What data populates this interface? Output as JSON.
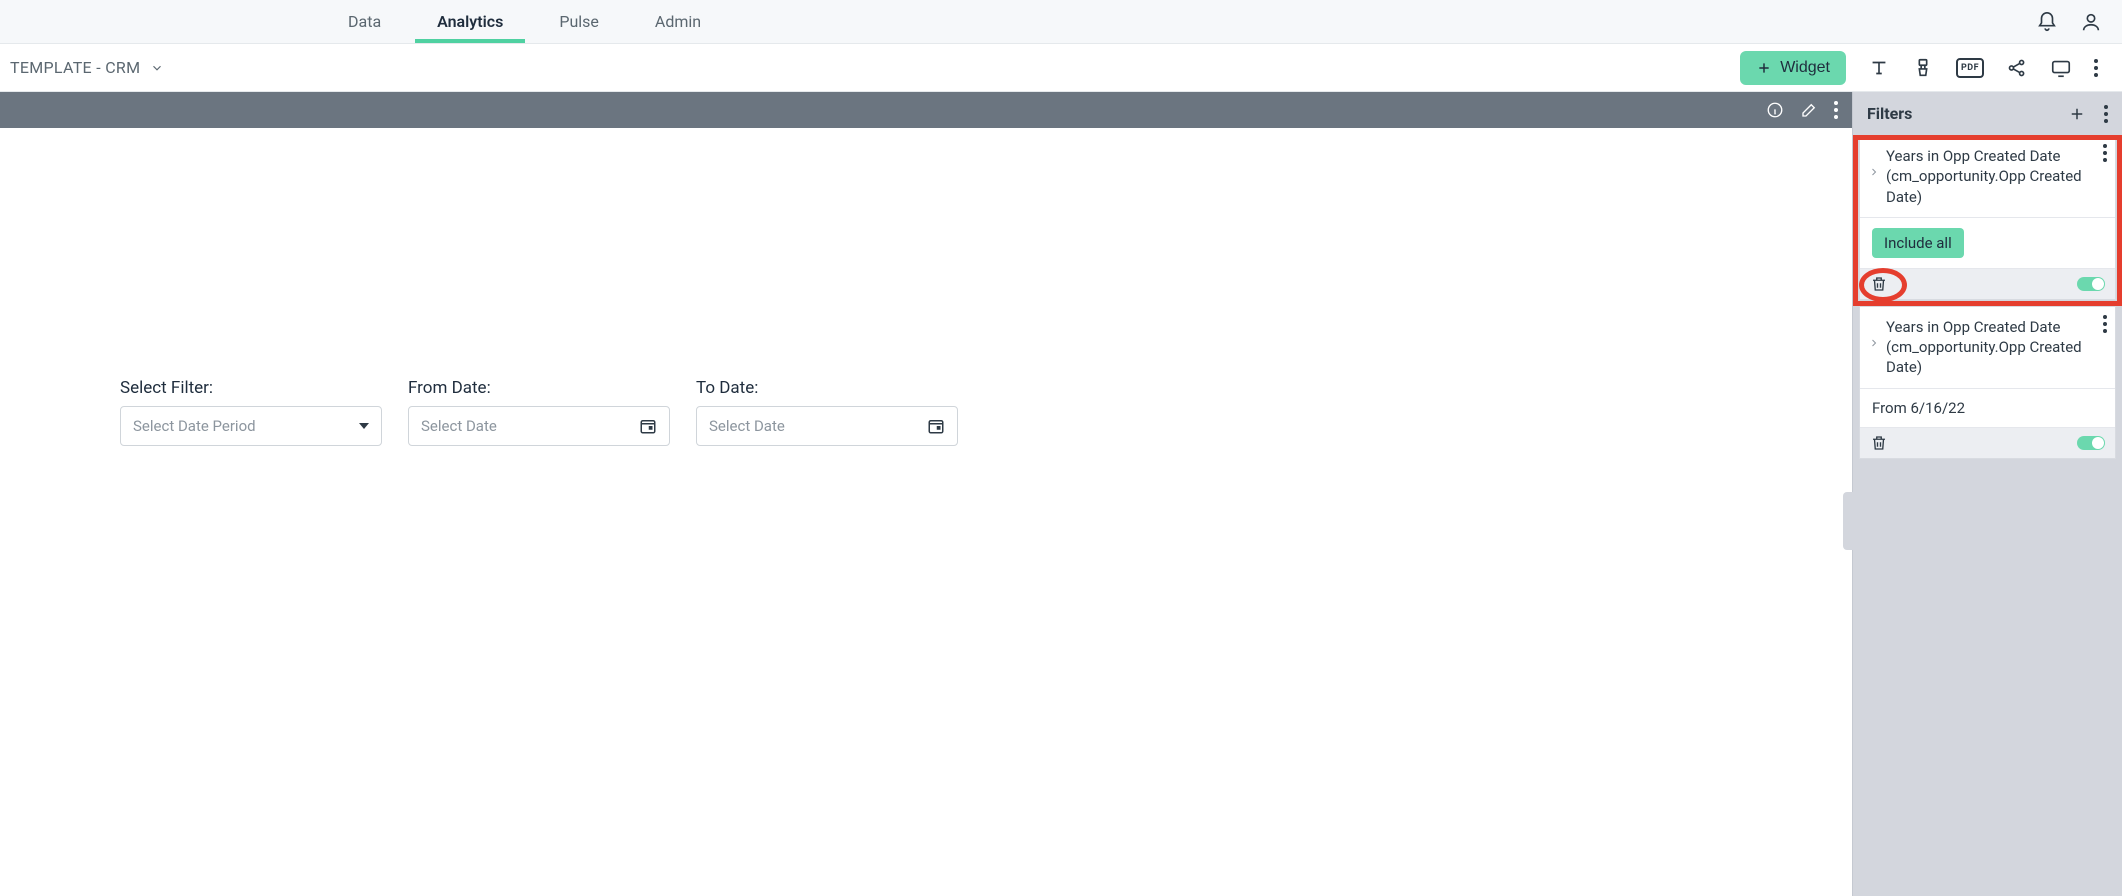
{
  "nav": {
    "tabs": [
      "Data",
      "Analytics",
      "Pulse",
      "Admin"
    ],
    "active_index": 1
  },
  "dashboard": {
    "title": "TEMPLATE - CRM",
    "widget_button": "Widget"
  },
  "canvas": {
    "select_filter_label": "Select Filter:",
    "select_filter_placeholder": "Select Date Period",
    "from_label": "From Date:",
    "from_placeholder": "Select Date",
    "to_label": "To Date:",
    "to_placeholder": "Select Date"
  },
  "filters_panel": {
    "header": "Filters",
    "cards": [
      {
        "title": "Years in Opp Created Date (cm_opportunity.Opp Created Date)",
        "selection_pill": "Include all",
        "body_text": null,
        "enabled": true,
        "highlighted": true
      },
      {
        "title": "Years in Opp Created Date (cm_opportunity.Opp Created Date)",
        "selection_pill": null,
        "body_text": "From 6/16/22",
        "enabled": true,
        "highlighted": false
      }
    ]
  }
}
